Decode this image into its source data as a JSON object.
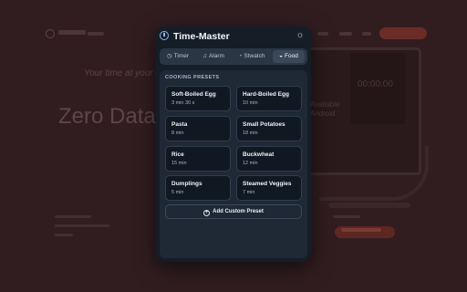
{
  "app": {
    "title": "Time-Master"
  },
  "icons": {
    "app": "stopwatch-icon",
    "theme": "sun-icon",
    "timer": "timer-icon",
    "alarm": "bell-icon",
    "stopwatch": "stopwatch-icon",
    "food": "food-icon",
    "add": "plus-circle-icon"
  },
  "tabs": [
    {
      "label": "Timer"
    },
    {
      "label": "Alarm"
    },
    {
      "label": "Stwatch"
    },
    {
      "label": "Food"
    }
  ],
  "active_tab": "Food",
  "section": {
    "title": "COOKING PRESETS"
  },
  "presets": [
    {
      "name": "Soft-Boiled Egg",
      "duration": "3 min 30 s"
    },
    {
      "name": "Hard-Boiled Egg",
      "duration": "10 min"
    },
    {
      "name": "Pasta",
      "duration": "8 min"
    },
    {
      "name": "Small Potatoes",
      "duration": "18 min"
    },
    {
      "name": "Rice",
      "duration": "15 min"
    },
    {
      "name": "Buckwheat",
      "duration": "12 min"
    },
    {
      "name": "Dumplings",
      "duration": "5 min"
    },
    {
      "name": "Steamed Veggies",
      "duration": "7 min"
    }
  ],
  "add_button": {
    "label": "Add Custom Preset"
  },
  "background": {
    "tagline": "Your time at your con",
    "hero": "Zero Data",
    "side_line1": "Available",
    "side_line2": "Android",
    "monitor_time": "00:00:00"
  },
  "colors": {
    "accent": "#8fb8e8",
    "popup_bg": "#151d27",
    "page_bg": "#311d20"
  }
}
